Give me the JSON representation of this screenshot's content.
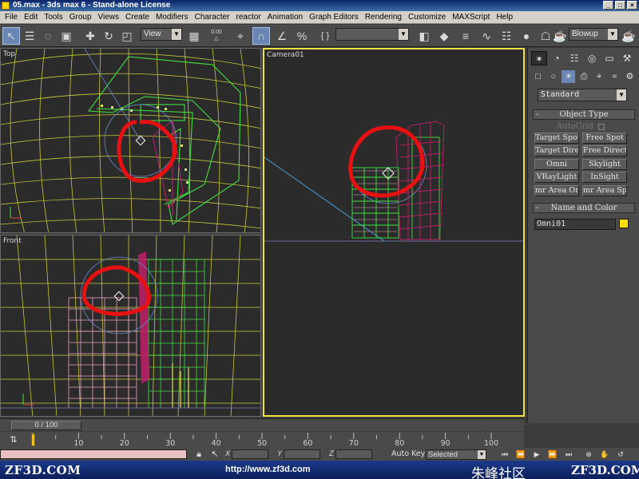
{
  "window": {
    "title": "05.max - 3ds max 6 - Stand-alone License",
    "controls": [
      "_",
      "□",
      "×"
    ]
  },
  "menu": [
    "File",
    "Edit",
    "Tools",
    "Group",
    "Views",
    "Create",
    "Modifiers",
    "Character",
    "reactor",
    "Animation",
    "Graph Editors",
    "Rendering",
    "Customize",
    "MAXScript",
    "Help"
  ],
  "toolbar": {
    "reference_coord": "View",
    "named_selection": "",
    "render_preset": "Blowup",
    "angle_snap_label": "0.00"
  },
  "viewports": {
    "top_left": {
      "label": "Top"
    },
    "camera": {
      "label": "Camera01"
    },
    "front": {
      "label": "Front"
    }
  },
  "command_panel": {
    "category": "Standard",
    "object_type_title": "Object Type",
    "autogrid_label": "AutoGrid",
    "buttons": [
      "Target Spot",
      "Free Spot",
      "Target Direct",
      "Free Direct",
      "Omni",
      "Skylight",
      "VRayLight",
      "InSight",
      "mr Area Omni",
      "mr Area Spot"
    ],
    "name_color_title": "Name and Color",
    "object_name": "Omni01",
    "object_color": "#ffe000"
  },
  "timeline": {
    "slider_text": "0 / 100",
    "current_frame": 0,
    "ticks": [
      "10",
      "20",
      "30",
      "40",
      "50",
      "60",
      "70",
      "80",
      "90",
      "100"
    ]
  },
  "status": {
    "coord_labels": [
      "X",
      "Y",
      "Z"
    ],
    "auto_key_label": "Auto Key",
    "selection_mode": "Selected"
  },
  "watermark": {
    "left": "ZF3D.COM",
    "url": "http://www.zf3d.com",
    "chinese": "朱峰社区",
    "right": "ZF3D.COM"
  },
  "colors": {
    "annotation_circle": "#e81010",
    "wireframe_grid": "#c8c83a",
    "building_green": "#40e040",
    "building_magenta": "#c0206a"
  }
}
